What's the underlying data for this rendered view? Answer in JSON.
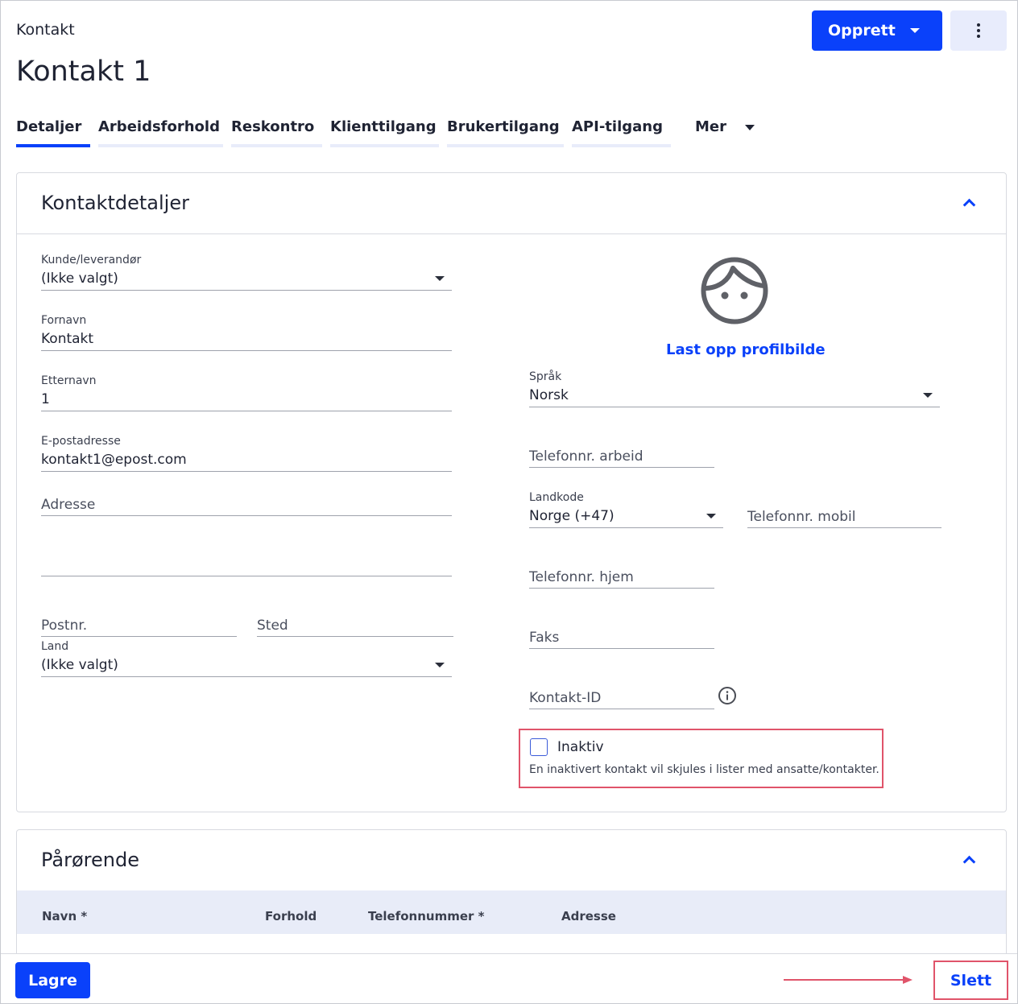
{
  "header": {
    "breadcrumb": "Kontakt",
    "title": "Kontakt 1",
    "create_button": "Opprett"
  },
  "tabs": [
    {
      "label": "Detaljer",
      "active": true
    },
    {
      "label": "Arbeidsforhold"
    },
    {
      "label": "Reskontro"
    },
    {
      "label": "Klienttilgang"
    },
    {
      "label": "Brukertilgang"
    },
    {
      "label": "API-tilgang"
    },
    {
      "label": "Mer"
    }
  ],
  "contact_details": {
    "title": "Kontaktdetaljer",
    "customer_supplier": {
      "label": "Kunde/leverandør",
      "value": "(Ikke valgt)"
    },
    "first_name": {
      "label": "Fornavn",
      "value": "Kontakt"
    },
    "last_name": {
      "label": "Etternavn",
      "value": "1"
    },
    "email": {
      "label": "E-postadresse",
      "value": "kontakt1@epost.com"
    },
    "address": {
      "placeholder": "Adresse"
    },
    "postal_code": {
      "placeholder": "Postnr."
    },
    "city": {
      "placeholder": "Sted"
    },
    "country": {
      "label": "Land",
      "value": "(Ikke valgt)"
    },
    "upload_profile_picture": "Last opp profilbilde",
    "language": {
      "label": "Språk",
      "value": "Norsk"
    },
    "phone_work": {
      "placeholder": "Telefonnr. arbeid"
    },
    "country_code": {
      "label": "Landkode",
      "value": "Norge (+47)"
    },
    "phone_mobile": {
      "placeholder": "Telefonnr. mobil"
    },
    "phone_home": {
      "placeholder": "Telefonnr. hjem"
    },
    "fax": {
      "placeholder": "Faks"
    },
    "contact_id": {
      "placeholder": "Kontakt-ID"
    },
    "inactive": {
      "label": "Inaktiv",
      "checked": false,
      "help": "En inaktivert kontakt vil skjules i lister med ansatte/kontakter."
    }
  },
  "relatives": {
    "title": "Pårørende",
    "columns": [
      "Navn *",
      "Forhold",
      "Telefonnummer *",
      "Adresse"
    ]
  },
  "footer": {
    "save_button": "Lagre",
    "delete_button": "Slett"
  },
  "colors": {
    "primary": "#0a41fa",
    "highlight": "#e0546a"
  }
}
